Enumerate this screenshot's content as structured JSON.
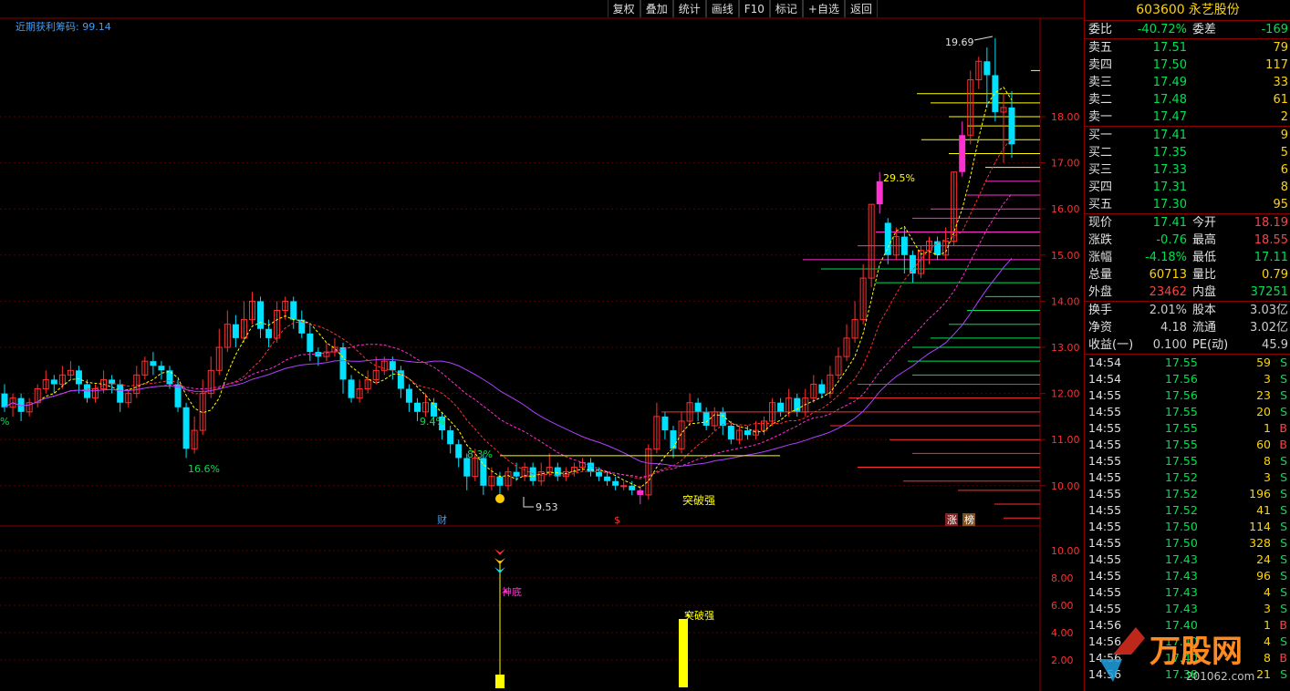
{
  "indicator": {
    "name": "近期获利筹码",
    "value": "99.14"
  },
  "toolbar": [
    "复权",
    "叠加",
    "统计",
    "画线",
    "F10",
    "标记",
    "+自选",
    "返回"
  ],
  "stock": {
    "code": "603600",
    "name": "永艺股份"
  },
  "order_book": {
    "wei_bi_label": "委比",
    "wei_bi": "-40.72%",
    "wei_cha_label": "委差",
    "wei_cha": "-169",
    "asks": [
      {
        "label": "卖五",
        "price": "17.51",
        "vol": "79"
      },
      {
        "label": "卖四",
        "price": "17.50",
        "vol": "117"
      },
      {
        "label": "卖三",
        "price": "17.49",
        "vol": "33"
      },
      {
        "label": "卖二",
        "price": "17.48",
        "vol": "61"
      },
      {
        "label": "卖一",
        "price": "17.47",
        "vol": "2"
      }
    ],
    "bids": [
      {
        "label": "买一",
        "price": "17.41",
        "vol": "9"
      },
      {
        "label": "买二",
        "price": "17.35",
        "vol": "5"
      },
      {
        "label": "买三",
        "price": "17.33",
        "vol": "6"
      },
      {
        "label": "买四",
        "price": "17.31",
        "vol": "8"
      },
      {
        "label": "买五",
        "price": "17.30",
        "vol": "95"
      }
    ]
  },
  "quote": [
    {
      "l1": "现价",
      "v1": "17.41",
      "c1": "green",
      "l2": "今开",
      "v2": "18.19",
      "c2": "red"
    },
    {
      "l1": "涨跌",
      "v1": "-0.76",
      "c1": "green",
      "l2": "最高",
      "v2": "18.55",
      "c2": "red"
    },
    {
      "l1": "涨幅",
      "v1": "-4.18%",
      "c1": "green",
      "l2": "最低",
      "v2": "17.11",
      "c2": "green"
    },
    {
      "l1": "总量",
      "v1": "60713",
      "c1": "yellow",
      "l2": "量比",
      "v2": "0.79",
      "c2": "yellow"
    },
    {
      "l1": "外盘",
      "v1": "23462",
      "c1": "red",
      "l2": "内盘",
      "v2": "37251",
      "c2": "green"
    }
  ],
  "fundamentals": [
    {
      "l1": "换手",
      "v1": "2.01%",
      "l2": "股本",
      "v2": "3.03亿"
    },
    {
      "l1": "净资",
      "v1": "4.18",
      "l2": "流通",
      "v2": "3.02亿"
    },
    {
      "l1": "收益(一)",
      "v1": "0.100",
      "l2": "PE(动)",
      "v2": "45.9"
    }
  ],
  "ticks": [
    {
      "t": "14:54",
      "p": "17.55",
      "q": "59",
      "d": "S"
    },
    {
      "t": "14:54",
      "p": "17.56",
      "q": "3",
      "d": "S"
    },
    {
      "t": "14:55",
      "p": "17.56",
      "q": "23",
      "d": "S"
    },
    {
      "t": "14:55",
      "p": "17.55",
      "q": "20",
      "d": "S"
    },
    {
      "t": "14:55",
      "p": "17.55",
      "q": "1",
      "d": "B"
    },
    {
      "t": "14:55",
      "p": "17.55",
      "q": "60",
      "d": "B"
    },
    {
      "t": "14:55",
      "p": "17.55",
      "q": "8",
      "d": "S"
    },
    {
      "t": "14:55",
      "p": "17.52",
      "q": "3",
      "d": "S"
    },
    {
      "t": "14:55",
      "p": "17.52",
      "q": "196",
      "d": "S"
    },
    {
      "t": "14:55",
      "p": "17.52",
      "q": "41",
      "d": "S"
    },
    {
      "t": "14:55",
      "p": "17.50",
      "q": "114",
      "d": "S"
    },
    {
      "t": "14:55",
      "p": "17.50",
      "q": "328",
      "d": "S"
    },
    {
      "t": "14:55",
      "p": "17.43",
      "q": "24",
      "d": "S"
    },
    {
      "t": "14:55",
      "p": "17.43",
      "q": "96",
      "d": "S"
    },
    {
      "t": "14:55",
      "p": "17.43",
      "q": "4",
      "d": "S"
    },
    {
      "t": "14:55",
      "p": "17.43",
      "q": "3",
      "d": "S"
    },
    {
      "t": "14:56",
      "p": "17.40",
      "q": "1",
      "d": "B"
    },
    {
      "t": "14:56",
      "p": "17.40",
      "q": "4",
      "d": "S"
    },
    {
      "t": "14:56",
      "p": "17.40",
      "q": "8",
      "d": "B"
    },
    {
      "t": "14:56",
      "p": "17.38",
      "q": "21",
      "d": "S"
    }
  ],
  "main_axis": [
    "18.00",
    "17.00",
    "16.00",
    "15.00",
    "14.00",
    "13.00",
    "12.00",
    "11.00",
    "10.00"
  ],
  "sub_axis": [
    "10.00",
    "8.00",
    "6.00",
    "4.00",
    "2.00"
  ],
  "annotations": {
    "high": "19.69",
    "low": "9.53",
    "pct1": "16.6%",
    "pct2": "9.4%",
    "pct3": "8.3%",
    "pct4": "29.5%",
    "breakout": "突破强",
    "divine_bottom": "神底",
    "star_breakout": "突破强",
    "cai": "财",
    "dollar": "$",
    "zhang": "涨",
    "bang": "榜",
    "left_pct": "%"
  },
  "watermark": {
    "text": "万股网",
    "url": "201062.com"
  },
  "colors": {
    "up": "#ff3030",
    "down": "#00e0ff",
    "magenta": "#ff30d0",
    "yellow": "#ffff00",
    "grid": "#8b0000"
  }
}
